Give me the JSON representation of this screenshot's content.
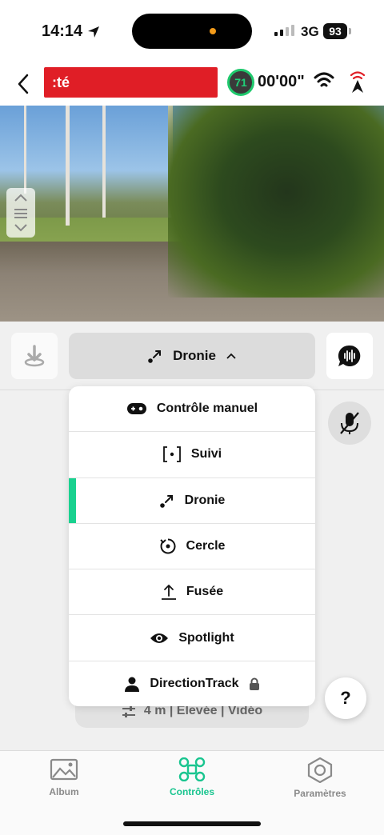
{
  "status_bar": {
    "time": "14:14",
    "network": "3G",
    "battery": "93"
  },
  "top_bar": {
    "flight_mode_text": ":té",
    "battery_percent": "71",
    "flight_time": "00'00\""
  },
  "controls": {
    "mode_label": "Dronie"
  },
  "mode_menu": {
    "items": [
      {
        "label": "Contrôle manuel",
        "icon": "gamepad-icon"
      },
      {
        "label": "Suivi",
        "icon": "follow-target-icon"
      },
      {
        "label": "Dronie",
        "icon": "dronie-icon",
        "active": true
      },
      {
        "label": "Cercle",
        "icon": "circle-orbit-icon"
      },
      {
        "label": "Fusée",
        "icon": "rocket-icon"
      },
      {
        "label": "Spotlight",
        "icon": "eye-icon"
      },
      {
        "label": "DirectionTrack",
        "icon": "person-icon",
        "locked": true
      }
    ]
  },
  "settings_pill": {
    "text": "4 m | Élevée | Vidéo"
  },
  "help": {
    "label": "?"
  },
  "tabs": [
    {
      "label": "Album",
      "active": false
    },
    {
      "label": "Contrôles",
      "active": true
    },
    {
      "label": "Paramètres",
      "active": false
    }
  ],
  "colors": {
    "accent": "#19c58f",
    "alert": "#e01e26",
    "battery_ring": "#1fc96d"
  }
}
